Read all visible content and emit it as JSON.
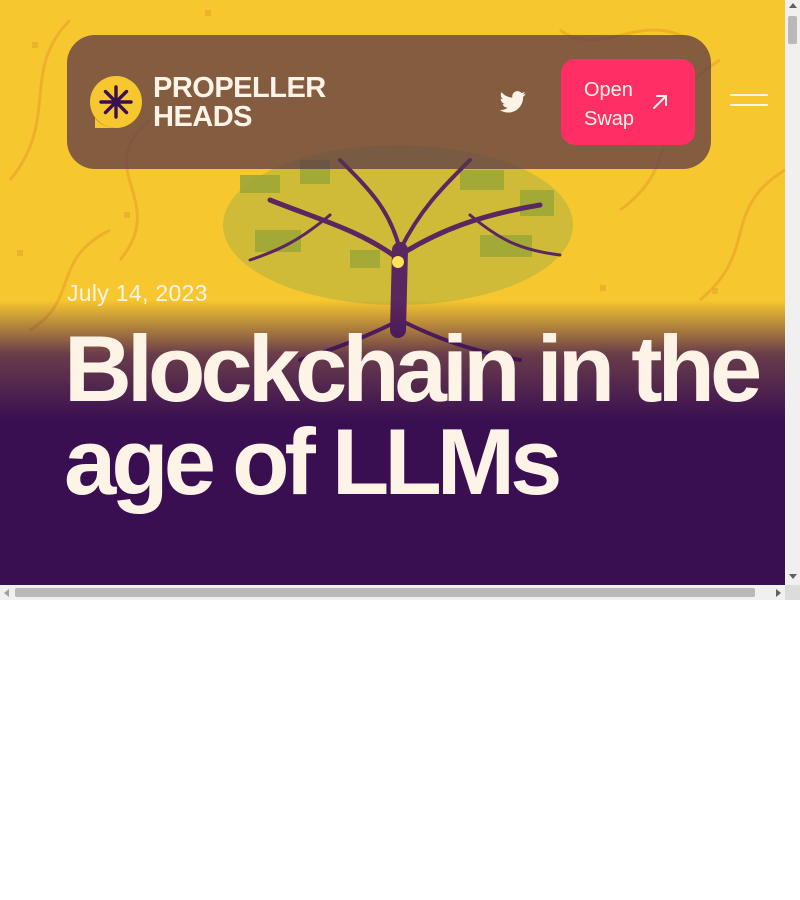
{
  "brand": {
    "name_line1": "PROPELLER",
    "name_line2": "HEADS",
    "logo_icon": "asterisk-logo-icon"
  },
  "nav": {
    "twitter_icon": "twitter-bird-icon",
    "cta_label": "Open Swap",
    "cta_icon": "arrow-up-right-icon",
    "menu_icon": "hamburger-menu-icon"
  },
  "post": {
    "date": "July 14, 2023",
    "title": "Blockchain in the age of LLMs"
  },
  "colors": {
    "hero_yellow": "#f7c72f",
    "hero_purple": "#3a0f52",
    "nav_bg": "#583448",
    "cta_pink": "#ff2f66",
    "text_cream": "#fdf3e6"
  }
}
